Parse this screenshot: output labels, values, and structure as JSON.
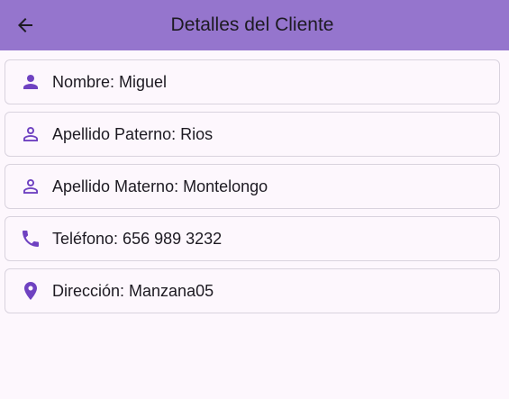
{
  "appbar": {
    "title": "Detalles del Cliente",
    "back_icon": "arrow-back-icon",
    "background": "#9575cd"
  },
  "accent": "#6f42c1",
  "details": [
    {
      "icon": "person-filled-icon",
      "text": "Nombre: Miguel"
    },
    {
      "icon": "person-outline-icon",
      "text": "Apellido Paterno: Rios"
    },
    {
      "icon": "person-outline-icon",
      "text": "Apellido Materno: Montelongo"
    },
    {
      "icon": "phone-icon",
      "text": "Teléfono: 656 989 3232"
    },
    {
      "icon": "location-pin-icon",
      "text": "Dirección: Manzana05"
    }
  ]
}
